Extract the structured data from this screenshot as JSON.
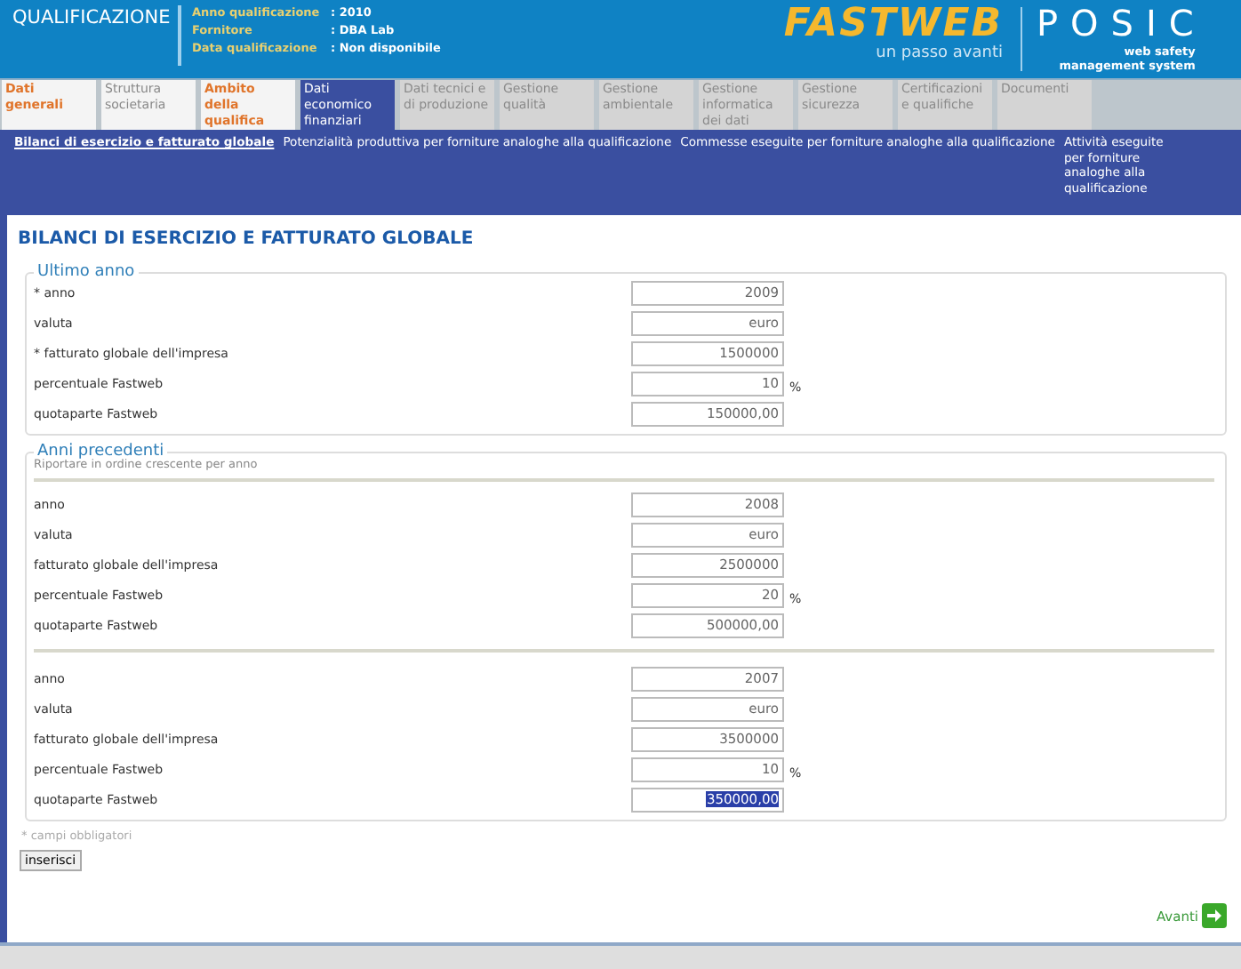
{
  "header": {
    "title": "QUALIFICAZIONE",
    "info": [
      {
        "label": "Anno qualificazione",
        "value": ": 2010"
      },
      {
        "label": "Fornitore",
        "value": ": DBA Lab"
      },
      {
        "label": "Data qualificazione",
        "value": ": Non disponibile"
      }
    ],
    "logo": {
      "brand": "FASTWEB",
      "tagline": "un passo avanti"
    },
    "product": {
      "name": "POSIC",
      "tagline": [
        "web safety",
        "management system"
      ]
    }
  },
  "tabs": [
    {
      "label": "Dati generali",
      "selected": false,
      "completed": true,
      "disabled": false
    },
    {
      "label": "Struttura societaria",
      "selected": false,
      "completed": false,
      "disabled": false
    },
    {
      "label": "Ambito della qualifica",
      "selected": false,
      "completed": true,
      "disabled": false
    },
    {
      "label": "Dati economico finanziari",
      "selected": true,
      "completed": false,
      "disabled": false
    },
    {
      "label": "Dati tecnici e di produzione",
      "selected": false,
      "completed": false,
      "disabled": true
    },
    {
      "label": "Gestione qualità",
      "selected": false,
      "completed": false,
      "disabled": true
    },
    {
      "label": "Gestione ambientale",
      "selected": false,
      "completed": false,
      "disabled": true
    },
    {
      "label": "Gestione informatica dei dati",
      "selected": false,
      "completed": false,
      "disabled": true
    },
    {
      "label": "Gestione sicurezza",
      "selected": false,
      "completed": false,
      "disabled": true
    },
    {
      "label": "Certificazioni e qualifiche",
      "selected": false,
      "completed": false,
      "disabled": true
    },
    {
      "label": "Documenti",
      "selected": false,
      "completed": false,
      "disabled": true
    }
  ],
  "subnav": [
    {
      "label": "Bilanci di esercizio e fatturato globale",
      "selected": true
    },
    {
      "label": "Potenzialità produttiva per forniture analoghe alla qualificazione",
      "selected": false
    },
    {
      "label": "Commesse eseguite per forniture analoghe alla qualificazione",
      "selected": false
    },
    {
      "label": "Attività eseguite per forniture analoghe alla qualificazione",
      "selected": false
    }
  ],
  "heading": "BILANCI DI ESERCIZIO E FATTURATO GLOBALE",
  "sections": [
    {
      "legend": "Ultimo anno",
      "groups": [
        [
          {
            "label": "* anno",
            "value": "2009",
            "highlighted": false
          },
          {
            "label": "valuta",
            "value": "euro",
            "highlighted": false
          },
          {
            "label": "* fatturato globale dell'impresa",
            "value": "1500000",
            "highlighted": false
          },
          {
            "label": "percentuale Fastweb",
            "value": "10",
            "unit": "%",
            "highlighted": false
          },
          {
            "label": "quotaparte Fastweb",
            "value": "150000,00",
            "highlighted": false
          }
        ]
      ]
    },
    {
      "legend": "Anni precedenti",
      "hint": "Riportare in ordine crescente per anno",
      "groups": [
        [
          {
            "label": "anno",
            "value": "2008",
            "highlighted": false
          },
          {
            "label": "valuta",
            "value": "euro",
            "highlighted": false
          },
          {
            "label": "fatturato globale dell'impresa",
            "value": "2500000",
            "highlighted": false
          },
          {
            "label": "percentuale Fastweb",
            "value": "20",
            "unit": "%",
            "highlighted": false
          },
          {
            "label": "quotaparte Fastweb",
            "value": "500000,00",
            "highlighted": false
          }
        ],
        [
          {
            "label": "anno",
            "value": "2007",
            "highlighted": false
          },
          {
            "label": "valuta",
            "value": "euro",
            "highlighted": false
          },
          {
            "label": "fatturato globale dell'impresa",
            "value": "3500000",
            "highlighted": false
          },
          {
            "label": "percentuale Fastweb",
            "value": "10",
            "unit": "%",
            "highlighted": false
          },
          {
            "label": "quotaparte Fastweb",
            "value": "350000,00",
            "highlighted": true
          }
        ]
      ]
    }
  ],
  "note": "* campi obbligatori",
  "submit": "inserisci",
  "next": "Avanti"
}
